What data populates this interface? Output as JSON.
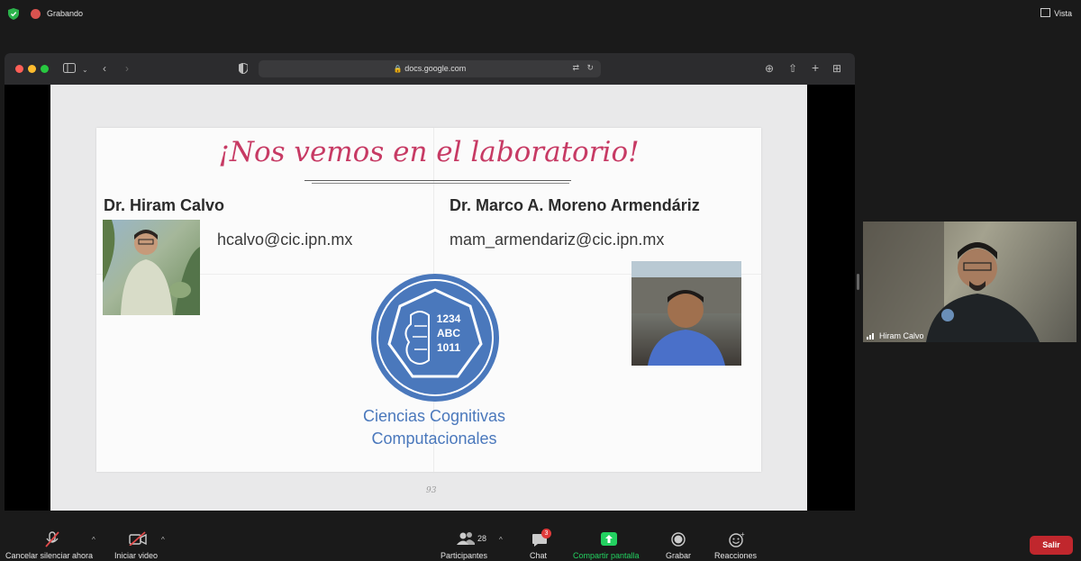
{
  "topbar": {
    "recording_label": "Grabando",
    "view_label": "Vista"
  },
  "browser": {
    "url": "docs.google.com"
  },
  "slide": {
    "heading": "¡Nos vemos en el laboratorio!",
    "person1": {
      "name": "Dr. Hiram Calvo",
      "email": "hcalvo@cic.ipn.mx"
    },
    "person2": {
      "name": "Dr. Marco A. Moreno Armendáriz",
      "email": "mam_armendariz@cic.ipn.mx"
    },
    "logo": {
      "line1": "1234",
      "line2": "ABC",
      "line3": "1011",
      "color": "#4a78bc"
    },
    "org_line1": "Ciencias Cognitivas",
    "org_line2": "Computacionales",
    "page_number": "93",
    "heading_color": "#c73a64"
  },
  "video": {
    "participant_name": "Hiram Calvo"
  },
  "controls": {
    "unmute_label": "Cancelar silenciar ahora",
    "start_video_label": "Iniciar video",
    "participants_label": "Participantes",
    "participants_count": "28",
    "chat_label": "Chat",
    "chat_badge": "3",
    "share_label": "Compartir pantalla",
    "record_label": "Grabar",
    "reactions_label": "Reacciones",
    "leave_label": "Salir",
    "share_color": "#23d160",
    "leave_color": "#c0272d"
  }
}
